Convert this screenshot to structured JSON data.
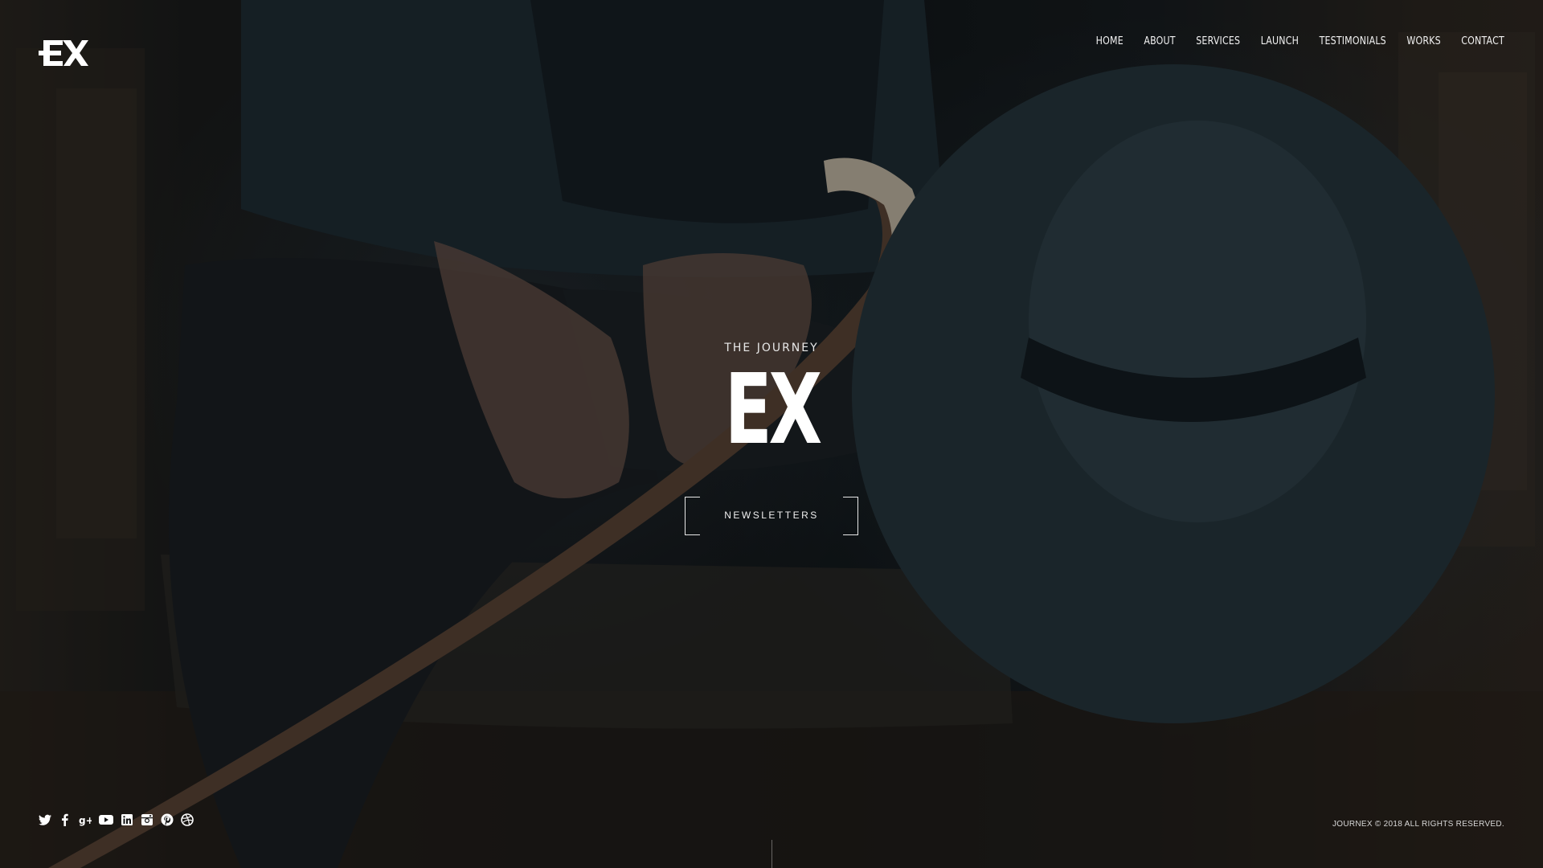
{
  "brand": {
    "logo_text": "EX"
  },
  "nav": {
    "items": [
      {
        "label": "HOME"
      },
      {
        "label": "ABOUT"
      },
      {
        "label": "SERVICES"
      },
      {
        "label": "LAUNCH"
      },
      {
        "label": "TESTIMONIALS"
      },
      {
        "label": "WORKS"
      },
      {
        "label": "CONTACT"
      }
    ]
  },
  "hero": {
    "subtitle": "THE JOURNEY",
    "title": "EX",
    "button_label": "NEWSLETTERS"
  },
  "socials": [
    "twitter-icon",
    "facebook-icon",
    "google-plus-icon",
    "youtube-icon",
    "linkedin-icon",
    "instagram-icon",
    "pinterest-icon",
    "dribbble-icon"
  ],
  "footer": {
    "copyright": "JOURNEX © 2018 ALL RIGHTS RESERVED."
  },
  "colors": {
    "text": "#ffffff",
    "overlay": "#0e1215"
  }
}
